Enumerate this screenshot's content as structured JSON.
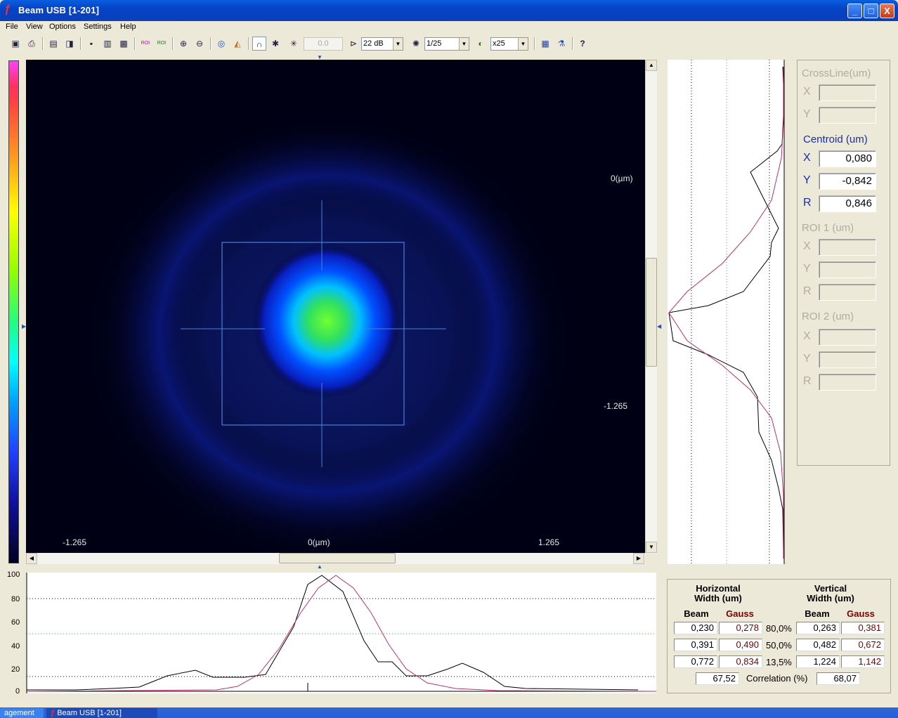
{
  "window": {
    "title": "Beam USB  [1-201]",
    "min_label": "_",
    "max_label": "□",
    "close_label": "X"
  },
  "menu": [
    "File",
    "View",
    "Options",
    "Settings",
    "Help"
  ],
  "toolbar": {
    "exposure_value": "0.0",
    "gain_label": "22 dB",
    "rate_label": "1/25",
    "zoom_label": "x25",
    "help_label": "?"
  },
  "beam_view": {
    "label_center_top": "0(µm)",
    "label_center_bottom": "0(µm)",
    "label_left": "-1.265",
    "label_right": "1.265",
    "label_y_bottom": "-1.265"
  },
  "vprofile": {
    "ticks": [
      "100",
      "80",
      "60",
      "40",
      "20",
      "0"
    ]
  },
  "hprofile": {
    "ticks": [
      "100",
      "80",
      "60",
      "40",
      "20",
      "0"
    ]
  },
  "info": {
    "crossline": {
      "title": "CrossLine(um)",
      "x_label": "X",
      "y_label": "Y",
      "x": "",
      "y": ""
    },
    "centroid": {
      "title": "Centroid (um)",
      "x_label": "X",
      "y_label": "Y",
      "r_label": "R",
      "x": "0,080",
      "y": "-0,842",
      "r": "0,846"
    },
    "roi1": {
      "title": "ROI 1 (um)",
      "x_label": "X",
      "y_label": "Y",
      "r_label": "R",
      "x": "",
      "y": "",
      "r": ""
    },
    "roi2": {
      "title": "ROI 2 (um)",
      "x_label": "X",
      "y_label": "Y",
      "r_label": "R",
      "x": "",
      "y": "",
      "r": ""
    }
  },
  "widths": {
    "h_title": "Horizontal",
    "h_sub": "Width  (um)",
    "v_title": "Vertical",
    "v_sub": "Width  (um)",
    "beam": "Beam",
    "gauss": "Gauss",
    "rows": [
      {
        "level": "80,0%",
        "h_beam": "0,230",
        "h_gauss": "0,278",
        "v_beam": "0,263",
        "v_gauss": "0,381"
      },
      {
        "level": "50,0%",
        "h_beam": "0,391",
        "h_gauss": "0,490",
        "v_beam": "0,482",
        "v_gauss": "0,672"
      },
      {
        "level": "13,5%",
        "h_beam": "0,772",
        "h_gauss": "0,834",
        "v_beam": "1,224",
        "v_gauss": "1,142"
      }
    ],
    "h_correlation": "67,52",
    "correlation_label": "Correlation (%)",
    "v_correlation": "68,07"
  },
  "taskbar": {
    "task1": "agement",
    "task2": "Beam USB  [1-201]"
  },
  "colors": {
    "title_bar": "#0543c7",
    "beam_curve": "#000000",
    "gauss_curve": "#c03070",
    "active_label": "#1a2fa0",
    "gauss_text": "#7a0000"
  }
}
